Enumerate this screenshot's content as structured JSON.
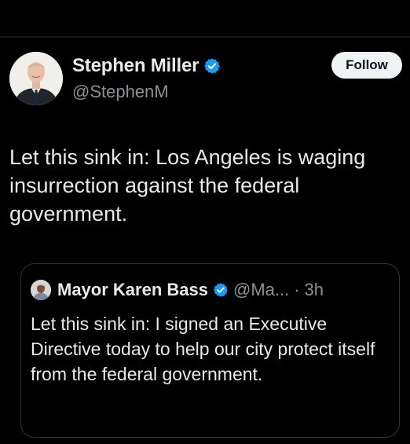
{
  "post": {
    "author": {
      "name": "Stephen Miller",
      "handle": "@StephenM",
      "verified": true,
      "avatar_icon": "profile-photo"
    },
    "follow_label": "Follow",
    "text": "Let this sink in: Los Angeles is waging insurrection against the federal government."
  },
  "quoted": {
    "author": {
      "name": "Mayor Karen Bass",
      "handle": "@Ma...",
      "verified": true,
      "avatar_icon": "profile-photo"
    },
    "separator": "·",
    "time": "3h",
    "text": "Let this sink in: I signed an Executive Directive today to help our city protect itself from the federal government."
  },
  "colors": {
    "background": "#000000",
    "text_primary": "#e7e9ea",
    "text_secondary": "#8b9196",
    "verified_badge": "#1d9bf0",
    "follow_button_bg": "#eff3f4",
    "border": "#2f3336"
  }
}
